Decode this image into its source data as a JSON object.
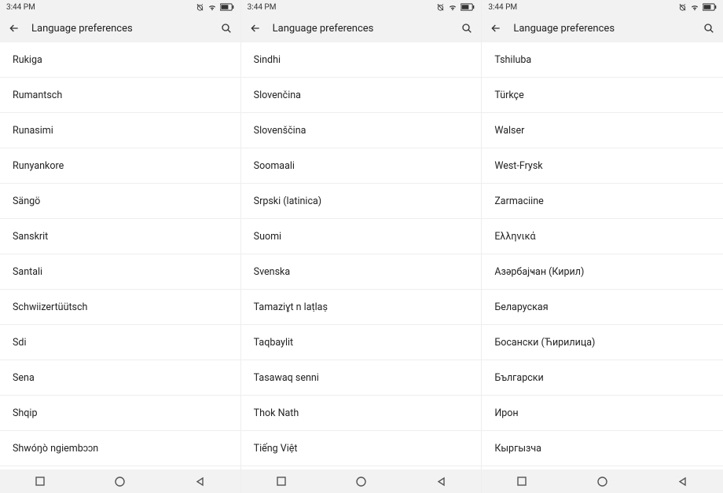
{
  "status_time": "3:44 PM",
  "app_bar_title": "Language preferences",
  "screens": [
    {
      "items": [
        "Rukiga",
        "Rumantsch",
        "Runasimi",
        "Runyankore",
        "Sängö",
        "Sanskrit",
        "Santali",
        "Schwiizertüütsch",
        "Sdi",
        "Sena",
        "Shqip",
        "Shwóŋò ngiembɔɔn"
      ]
    },
    {
      "items": [
        "Sindhi",
        "Slovenčina",
        "Slovenščina",
        "Soomaali",
        "Srpski (latinica)",
        "Suomi",
        "Svenska",
        "Tamaziɣt n laṭlaṣ",
        "Taqbaylit",
        "Tasawaq senni",
        "Thok Nath",
        "Tiếng Việt"
      ]
    },
    {
      "items": [
        "Tshiluba",
        "Türkçe",
        "Walser",
        "West-Frysk",
        "Zarmaciine",
        "Ελληνικά",
        "Азәрбајҹан (Кирил)",
        "Беларуская",
        "Босански (Ћирилица)",
        "Български",
        "Ирон",
        "Кыргызча"
      ]
    }
  ]
}
